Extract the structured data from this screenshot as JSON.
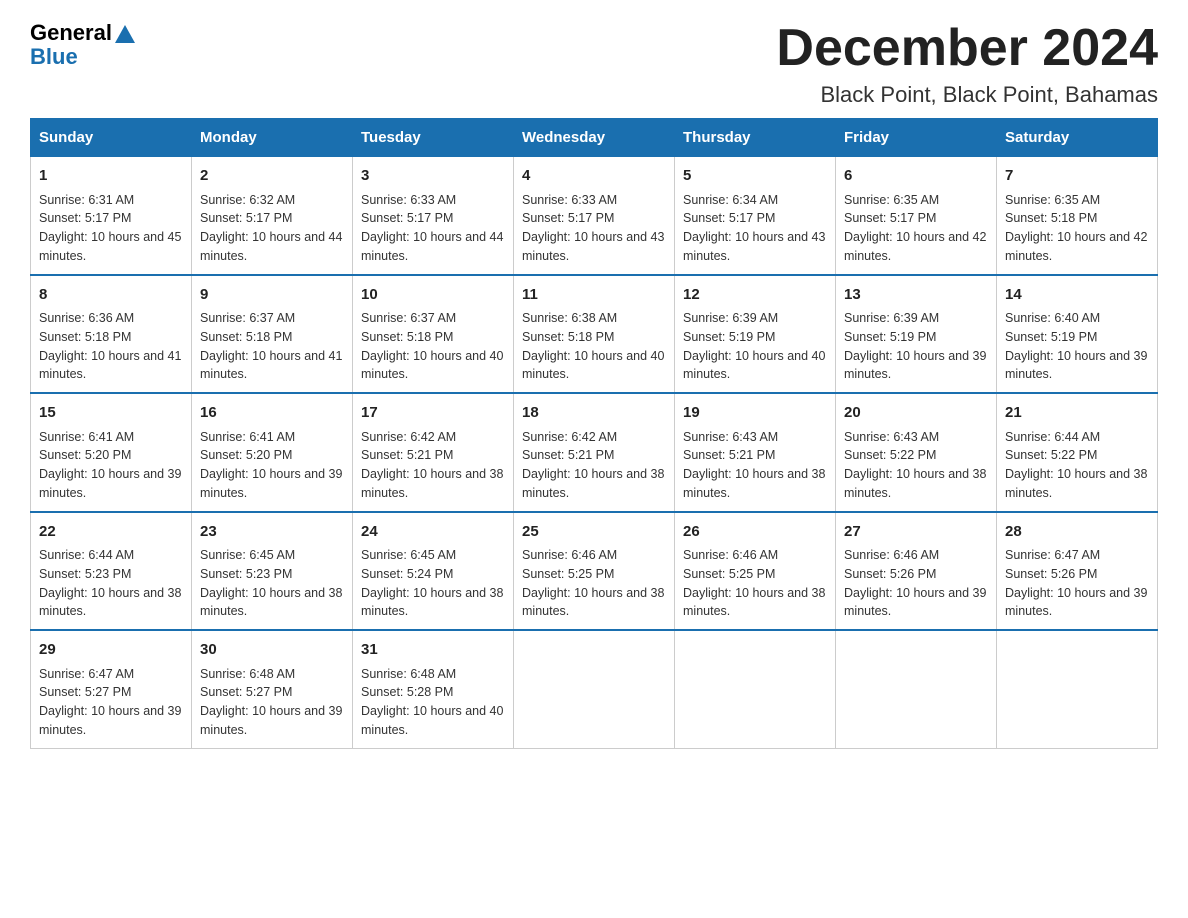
{
  "logo": {
    "general": "General",
    "blue": "Blue"
  },
  "title": {
    "month": "December 2024",
    "location": "Black Point, Black Point, Bahamas"
  },
  "weekdays": [
    "Sunday",
    "Monday",
    "Tuesday",
    "Wednesday",
    "Thursday",
    "Friday",
    "Saturday"
  ],
  "weeks": [
    [
      {
        "day": "1",
        "sunrise": "6:31 AM",
        "sunset": "5:17 PM",
        "daylight": "10 hours and 45 minutes."
      },
      {
        "day": "2",
        "sunrise": "6:32 AM",
        "sunset": "5:17 PM",
        "daylight": "10 hours and 44 minutes."
      },
      {
        "day": "3",
        "sunrise": "6:33 AM",
        "sunset": "5:17 PM",
        "daylight": "10 hours and 44 minutes."
      },
      {
        "day": "4",
        "sunrise": "6:33 AM",
        "sunset": "5:17 PM",
        "daylight": "10 hours and 43 minutes."
      },
      {
        "day": "5",
        "sunrise": "6:34 AM",
        "sunset": "5:17 PM",
        "daylight": "10 hours and 43 minutes."
      },
      {
        "day": "6",
        "sunrise": "6:35 AM",
        "sunset": "5:17 PM",
        "daylight": "10 hours and 42 minutes."
      },
      {
        "day": "7",
        "sunrise": "6:35 AM",
        "sunset": "5:18 PM",
        "daylight": "10 hours and 42 minutes."
      }
    ],
    [
      {
        "day": "8",
        "sunrise": "6:36 AM",
        "sunset": "5:18 PM",
        "daylight": "10 hours and 41 minutes."
      },
      {
        "day": "9",
        "sunrise": "6:37 AM",
        "sunset": "5:18 PM",
        "daylight": "10 hours and 41 minutes."
      },
      {
        "day": "10",
        "sunrise": "6:37 AM",
        "sunset": "5:18 PM",
        "daylight": "10 hours and 40 minutes."
      },
      {
        "day": "11",
        "sunrise": "6:38 AM",
        "sunset": "5:18 PM",
        "daylight": "10 hours and 40 minutes."
      },
      {
        "day": "12",
        "sunrise": "6:39 AM",
        "sunset": "5:19 PM",
        "daylight": "10 hours and 40 minutes."
      },
      {
        "day": "13",
        "sunrise": "6:39 AM",
        "sunset": "5:19 PM",
        "daylight": "10 hours and 39 minutes."
      },
      {
        "day": "14",
        "sunrise": "6:40 AM",
        "sunset": "5:19 PM",
        "daylight": "10 hours and 39 minutes."
      }
    ],
    [
      {
        "day": "15",
        "sunrise": "6:41 AM",
        "sunset": "5:20 PM",
        "daylight": "10 hours and 39 minutes."
      },
      {
        "day": "16",
        "sunrise": "6:41 AM",
        "sunset": "5:20 PM",
        "daylight": "10 hours and 39 minutes."
      },
      {
        "day": "17",
        "sunrise": "6:42 AM",
        "sunset": "5:21 PM",
        "daylight": "10 hours and 38 minutes."
      },
      {
        "day": "18",
        "sunrise": "6:42 AM",
        "sunset": "5:21 PM",
        "daylight": "10 hours and 38 minutes."
      },
      {
        "day": "19",
        "sunrise": "6:43 AM",
        "sunset": "5:21 PM",
        "daylight": "10 hours and 38 minutes."
      },
      {
        "day": "20",
        "sunrise": "6:43 AM",
        "sunset": "5:22 PM",
        "daylight": "10 hours and 38 minutes."
      },
      {
        "day": "21",
        "sunrise": "6:44 AM",
        "sunset": "5:22 PM",
        "daylight": "10 hours and 38 minutes."
      }
    ],
    [
      {
        "day": "22",
        "sunrise": "6:44 AM",
        "sunset": "5:23 PM",
        "daylight": "10 hours and 38 minutes."
      },
      {
        "day": "23",
        "sunrise": "6:45 AM",
        "sunset": "5:23 PM",
        "daylight": "10 hours and 38 minutes."
      },
      {
        "day": "24",
        "sunrise": "6:45 AM",
        "sunset": "5:24 PM",
        "daylight": "10 hours and 38 minutes."
      },
      {
        "day": "25",
        "sunrise": "6:46 AM",
        "sunset": "5:25 PM",
        "daylight": "10 hours and 38 minutes."
      },
      {
        "day": "26",
        "sunrise": "6:46 AM",
        "sunset": "5:25 PM",
        "daylight": "10 hours and 38 minutes."
      },
      {
        "day": "27",
        "sunrise": "6:46 AM",
        "sunset": "5:26 PM",
        "daylight": "10 hours and 39 minutes."
      },
      {
        "day": "28",
        "sunrise": "6:47 AM",
        "sunset": "5:26 PM",
        "daylight": "10 hours and 39 minutes."
      }
    ],
    [
      {
        "day": "29",
        "sunrise": "6:47 AM",
        "sunset": "5:27 PM",
        "daylight": "10 hours and 39 minutes."
      },
      {
        "day": "30",
        "sunrise": "6:48 AM",
        "sunset": "5:27 PM",
        "daylight": "10 hours and 39 minutes."
      },
      {
        "day": "31",
        "sunrise": "6:48 AM",
        "sunset": "5:28 PM",
        "daylight": "10 hours and 40 minutes."
      },
      null,
      null,
      null,
      null
    ]
  ]
}
